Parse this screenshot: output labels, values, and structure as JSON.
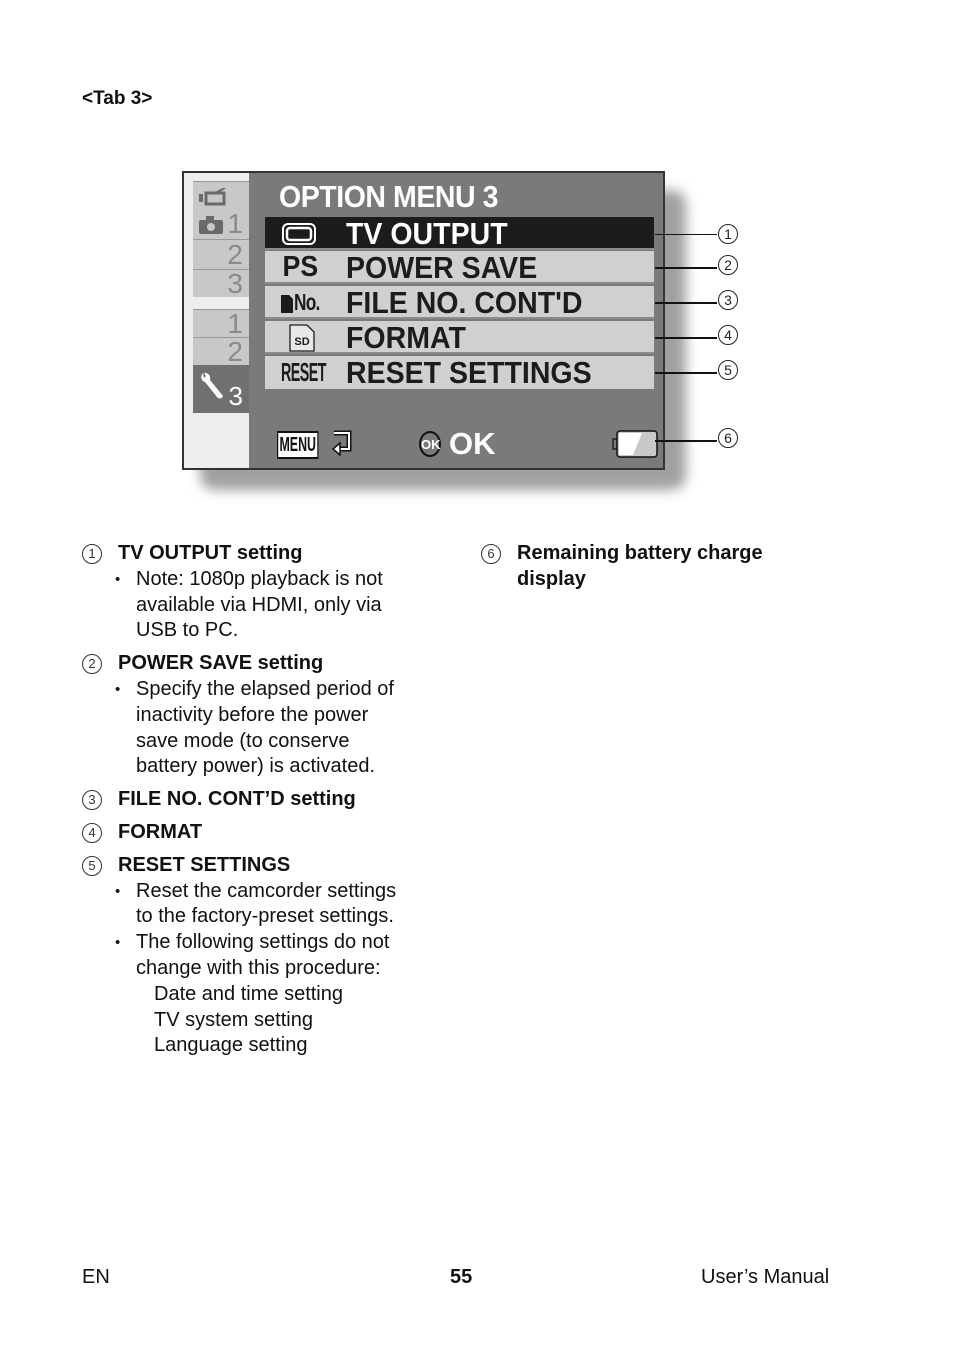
{
  "page": {
    "tab_heading": "<Tab 3>",
    "footer": {
      "left": "EN",
      "page_number": "55",
      "right": "User’s Manual"
    }
  },
  "screen": {
    "title": "OPTION MENU 3",
    "side_tabs": [
      {
        "label": "1",
        "icon": "video-camera-icon",
        "icon2": "camera-icon",
        "active": false
      },
      {
        "label": "2",
        "active": false
      },
      {
        "label": "3",
        "active": false
      },
      {
        "label": "1",
        "active": false
      },
      {
        "label": "2",
        "active": false
      },
      {
        "label": "3",
        "icon": "wrench-icon",
        "active": true
      }
    ],
    "menu_items": [
      {
        "icon": "tv-output-icon",
        "label": "TV OUTPUT",
        "selected": true
      },
      {
        "icon_text": "PS",
        "icon": "power-save-icon",
        "label": "POWER SAVE",
        "selected": false
      },
      {
        "icon_text": "No.",
        "icon": "file-number-icon",
        "label": "FILE NO. CONT'D",
        "selected": false
      },
      {
        "icon_text": "SD",
        "icon": "sd-card-icon",
        "label": "FORMAT",
        "selected": false
      },
      {
        "icon_text": "RESET",
        "icon": "reset-icon",
        "label": "RESET SETTINGS",
        "selected": false
      }
    ],
    "bottom_bar": {
      "menu_key": "MENU",
      "ok_key": "OK",
      "ok_label": "OK",
      "battery_level": 0.5
    },
    "callouts": [
      "1",
      "2",
      "3",
      "4",
      "5",
      "6"
    ]
  },
  "descriptions": {
    "left": [
      {
        "num": "1",
        "title": "TV OUTPUT setting",
        "bullets": [
          [
            "Note: 1080p playback is not",
            "available via HDMI, only via",
            "USB to PC."
          ]
        ]
      },
      {
        "num": "2",
        "title": "POWER SAVE setting",
        "bullets": [
          [
            "Specify the elapsed period of",
            "inactivity before the power",
            "save mode (to conserve",
            "battery power) is activated."
          ]
        ]
      },
      {
        "num": "3",
        "title": "FILE NO. CONT’D setting",
        "bullets": []
      },
      {
        "num": "4",
        "title": "FORMAT",
        "bullets": []
      },
      {
        "num": "5",
        "title": "RESET SETTINGS",
        "bullets": [
          [
            "Reset the camcorder settings",
            "to the factory-preset settings."
          ],
          [
            "The following settings do not",
            "change with this procedure:"
          ]
        ],
        "sublist": [
          "Date and time setting",
          "TV system setting",
          "Language setting"
        ]
      }
    ],
    "right": [
      {
        "num": "6",
        "title_lines": [
          "Remaining battery charge",
          "display"
        ]
      }
    ]
  }
}
